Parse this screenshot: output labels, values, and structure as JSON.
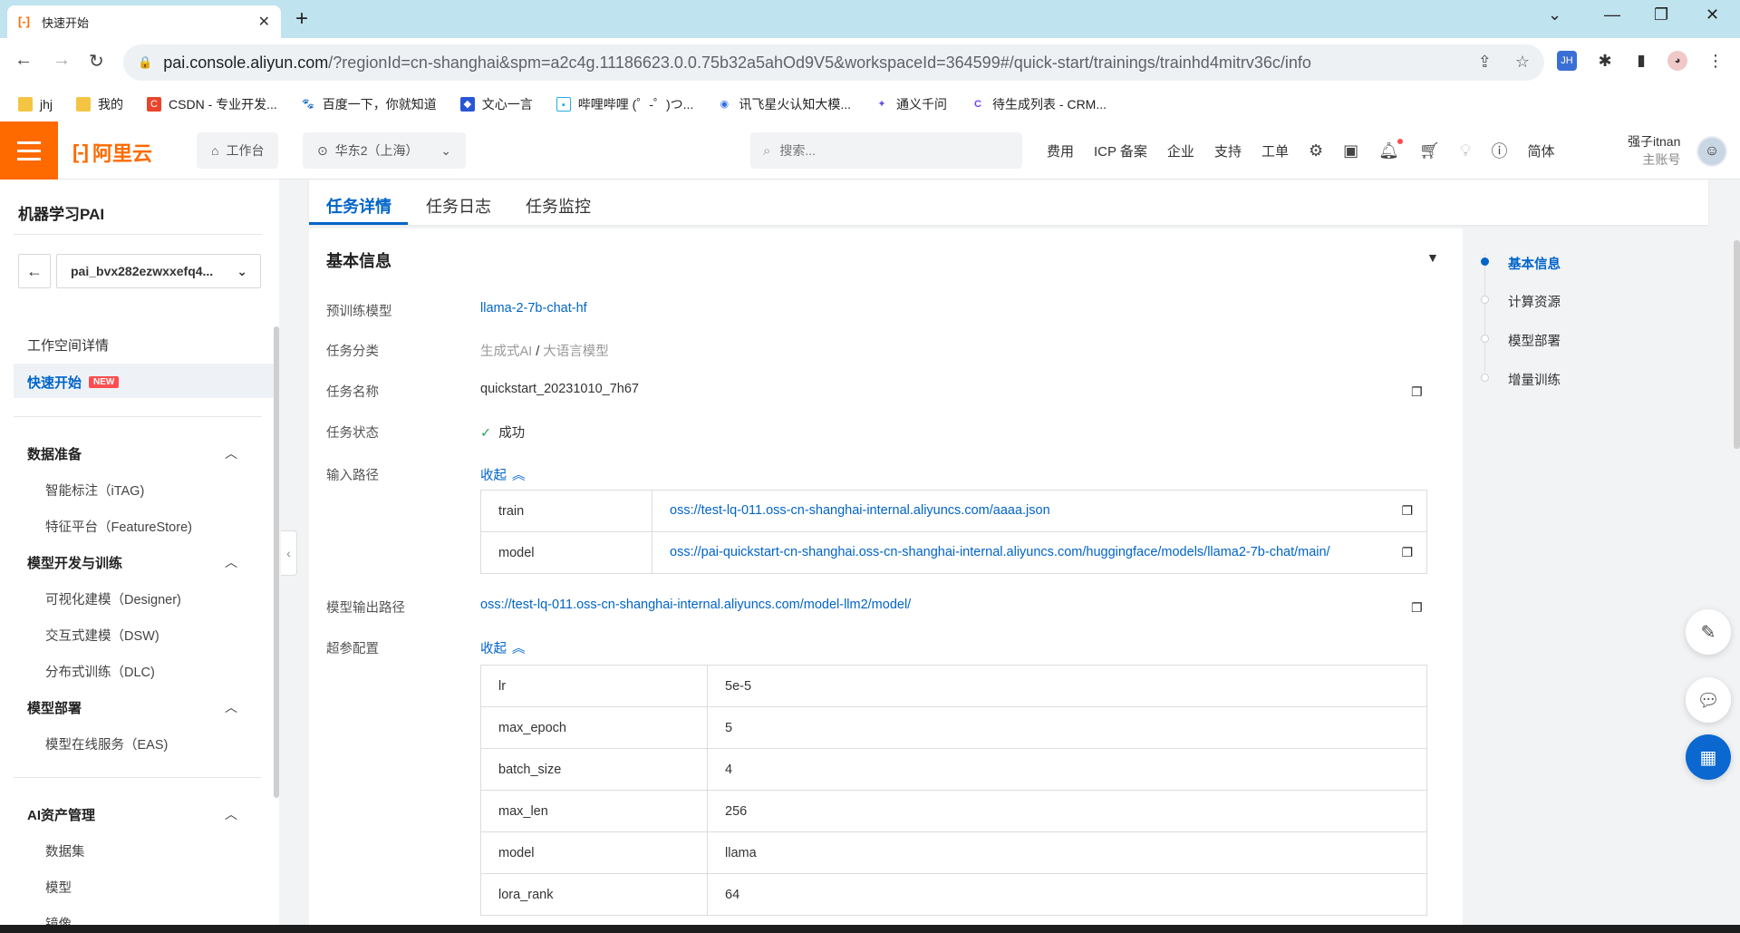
{
  "browser": {
    "tab_title": "快速开始",
    "url_host": "pai.console.aliyun.com",
    "url_path": "/?regionId=cn-shanghai&spm=a2c4g.11186623.0.0.75b32a5ahOd9V5&workspaceId=364599#/quick-start/trainings/trainhd4mitrv36c/info",
    "extension_label": "JH",
    "bookmarks": [
      {
        "label": "jhj",
        "icon": "folder-icon"
      },
      {
        "label": "我的",
        "icon": "folder-icon"
      },
      {
        "label": "CSDN - 专业开发...",
        "icon": "csdn-icon"
      },
      {
        "label": "百度一下，你就知道",
        "icon": "baidu-icon"
      },
      {
        "label": "文心一言",
        "icon": "wenxin-icon"
      },
      {
        "label": "哔哩哔哩 (゜-゜)つ...",
        "icon": "bilibili-icon"
      },
      {
        "label": "讯飞星火认知大模...",
        "icon": "xunfei-icon"
      },
      {
        "label": "通义千问",
        "icon": "tongyi-icon"
      },
      {
        "label": "待生成列表 - CRM...",
        "icon": "crm-icon"
      }
    ]
  },
  "topbar": {
    "logo_text": "阿里云",
    "workbench": "工作台",
    "region": "华东2（上海）",
    "search_placeholder": "搜索...",
    "nav": [
      "费用",
      "ICP 备案",
      "企业",
      "支持",
      "工单"
    ],
    "lang": "简体",
    "user_name": "强子itnan",
    "user_role": "主账号"
  },
  "sidebar": {
    "title": "机器学习PAI",
    "workspace": "pai_bvx282ezwxxefq4...",
    "workspace_detail": "工作空间详情",
    "quick_start": "快速开始",
    "new_badge": "NEW",
    "groups": [
      {
        "label": "数据准备",
        "items": [
          "智能标注（iTAG)",
          "特征平台（FeatureStore)"
        ]
      },
      {
        "label": "模型开发与训练",
        "items": [
          "可视化建模（Designer)",
          "交互式建模（DSW)",
          "分布式训练（DLC)"
        ]
      },
      {
        "label": "模型部署",
        "items": [
          "模型在线服务（EAS)"
        ]
      },
      {
        "label": "AI资产管理",
        "items": [
          "数据集",
          "模型",
          "镜像"
        ]
      }
    ]
  },
  "content_tabs": [
    "任务详情",
    "任务日志",
    "任务监控"
  ],
  "info": {
    "section_title": "基本信息",
    "labels": {
      "model": "预训练模型",
      "category": "任务分类",
      "name": "任务名称",
      "status": "任务状态",
      "input": "输入路径",
      "output": "模型输出路径",
      "hyper": "超参配置"
    },
    "model": "llama-2-7b-chat-hf",
    "category_a": "生成式AI",
    "category_sep": "/",
    "category_b": "大语言模型",
    "name": "quickstart_20231010_7h67",
    "status": "成功",
    "collapse": "收起",
    "input_paths": [
      {
        "key": "train",
        "value": "oss://test-lq-011.oss-cn-shanghai-internal.aliyuncs.com/aaaa.json"
      },
      {
        "key": "model",
        "value": "oss://pai-quickstart-cn-shanghai.oss-cn-shanghai-internal.aliyuncs.com/huggingface/models/llama2-7b-chat/main/"
      }
    ],
    "output_path": "oss://test-lq-011.oss-cn-shanghai-internal.aliyuncs.com/model-llm2/model/",
    "hyperparams": [
      {
        "key": "lr",
        "value": "5e-5"
      },
      {
        "key": "max_epoch",
        "value": "5"
      },
      {
        "key": "batch_size",
        "value": "4"
      },
      {
        "key": "max_len",
        "value": "256"
      },
      {
        "key": "model",
        "value": "llama"
      },
      {
        "key": "lora_rank",
        "value": "64"
      }
    ]
  },
  "anchor": [
    "基本信息",
    "计算资源",
    "模型部署",
    "增量训练"
  ],
  "colors": {
    "brand": "#ff6a00",
    "primary": "#0064c8",
    "success": "#23a55a"
  }
}
